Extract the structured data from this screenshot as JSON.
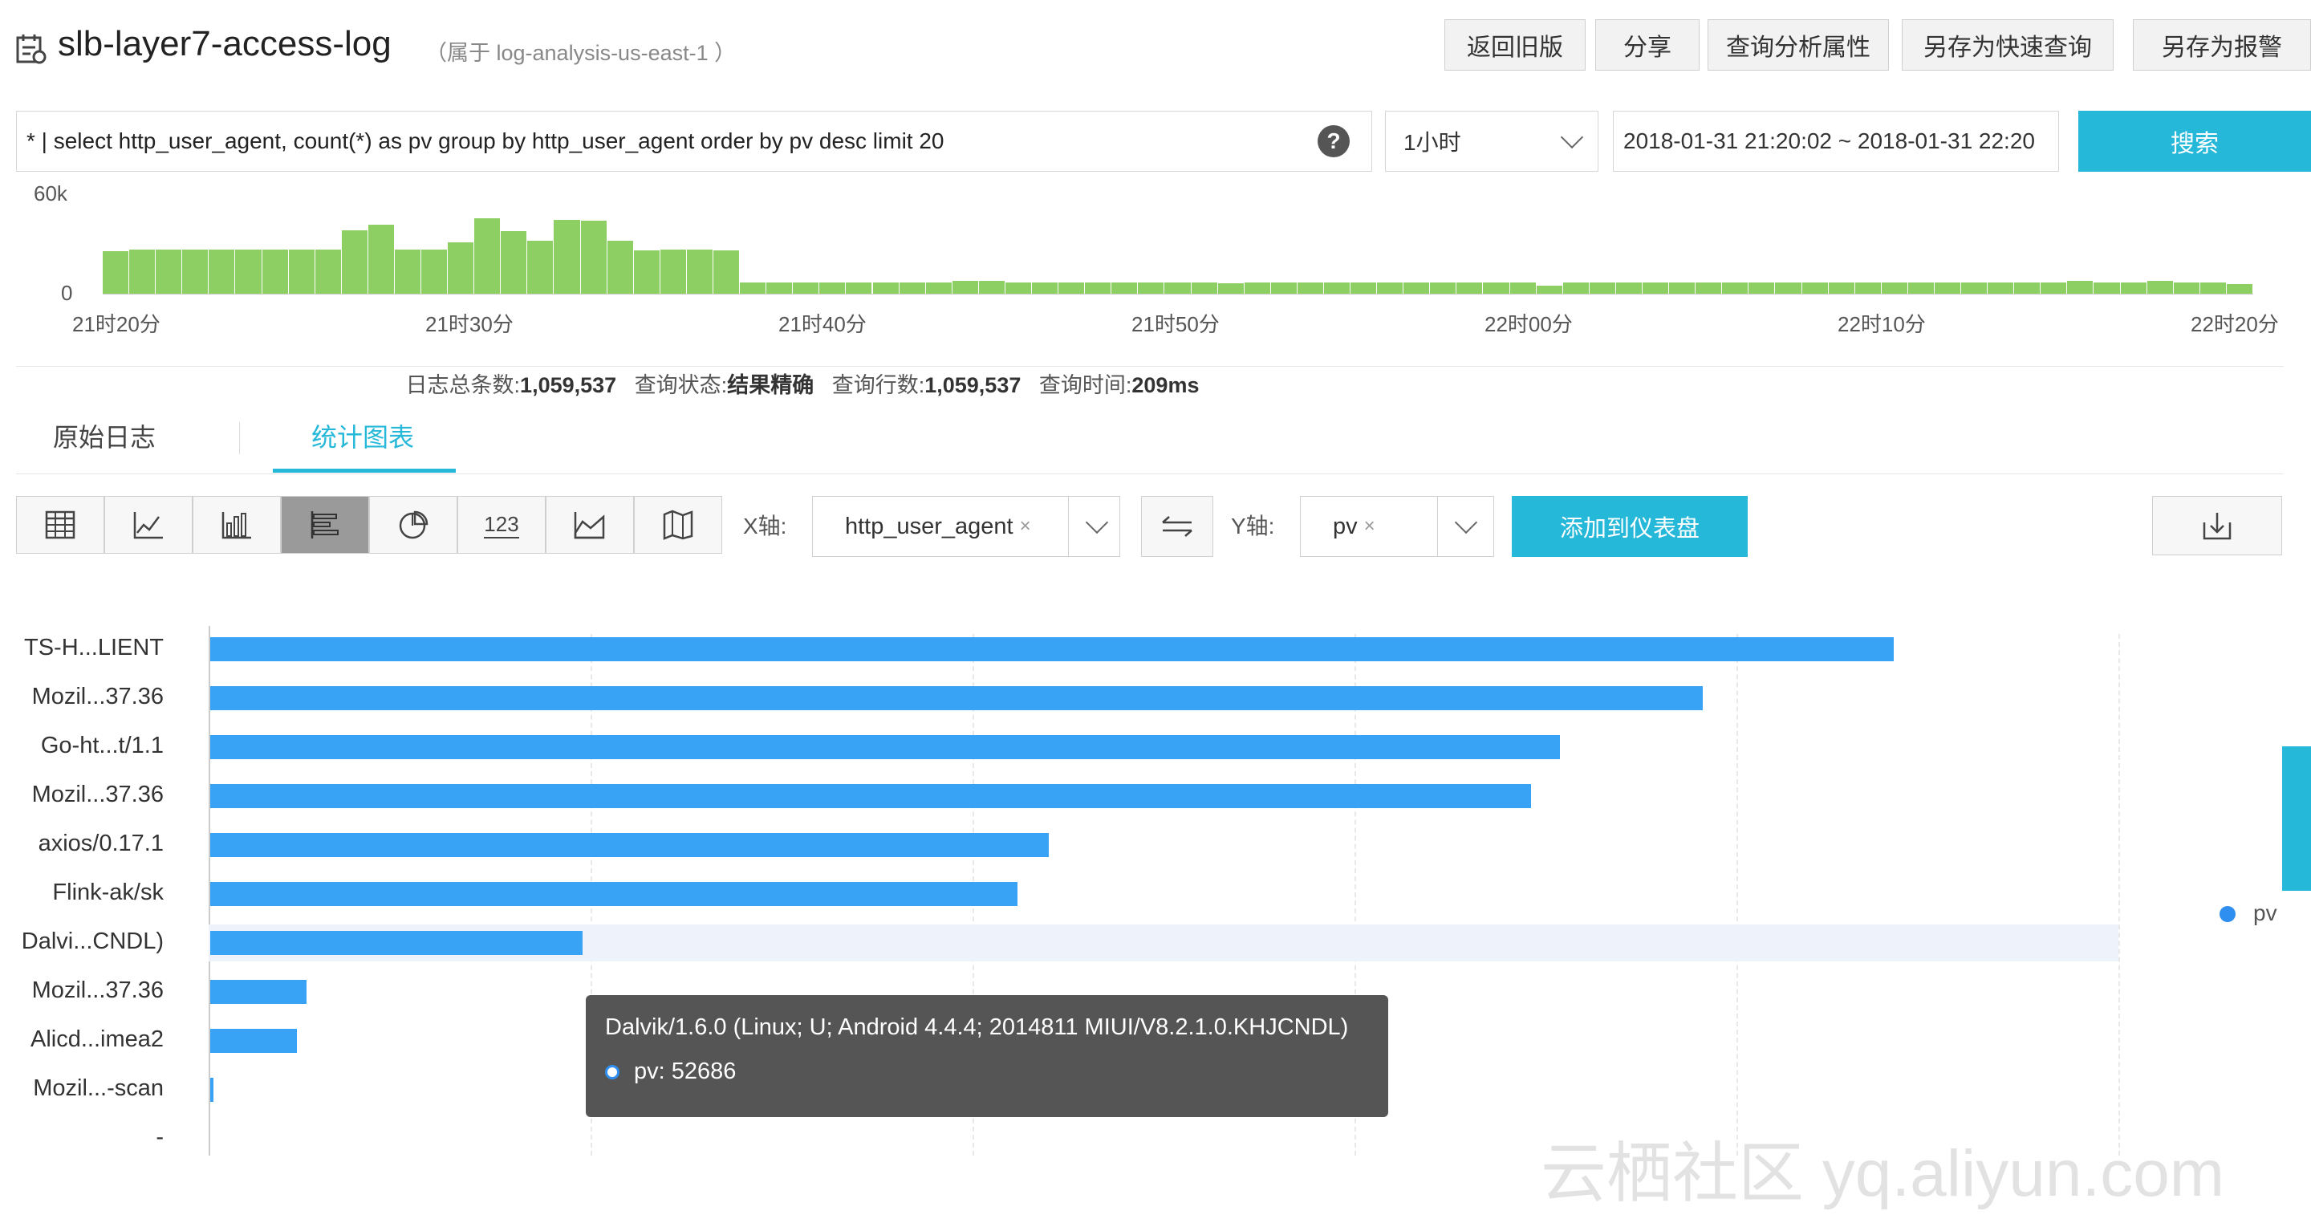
{
  "header": {
    "title": "slb-layer7-access-log",
    "belong": "（属于 log-analysis-us-east-1 ）",
    "buttons": [
      "返回旧版",
      "分享",
      "查询分析属性",
      "另存为快速查询",
      "另存为报警"
    ]
  },
  "query": {
    "text": "* | select http_user_agent, count(*) as pv group by http_user_agent order by pv desc limit 20",
    "help": "?",
    "range": "1小时",
    "time": "2018-01-31 21:20:02 ~ 2018-01-31 22:20",
    "search": "搜索"
  },
  "histogram": {
    "y_max_label": "60k",
    "y_min_label": "0",
    "x_labels": [
      "21时20分",
      "21时30分",
      "21时40分",
      "21时50分",
      "22时00分",
      "22时10分",
      "22时20分"
    ],
    "values": [
      0.44,
      0.46,
      0.46,
      0.46,
      0.46,
      0.46,
      0.46,
      0.46,
      0.46,
      0.66,
      0.72,
      0.46,
      0.46,
      0.53,
      0.78,
      0.65,
      0.55,
      0.77,
      0.76,
      0.55,
      0.45,
      0.46,
      0.46,
      0.45,
      0.12,
      0.12,
      0.12,
      0.12,
      0.12,
      0.12,
      0.12,
      0.12,
      0.13,
      0.13,
      0.12,
      0.12,
      0.12,
      0.12,
      0.12,
      0.12,
      0.12,
      0.12,
      0.11,
      0.12,
      0.12,
      0.12,
      0.12,
      0.12,
      0.12,
      0.12,
      0.12,
      0.12,
      0.12,
      0.12,
      0.08,
      0.12,
      0.12,
      0.12,
      0.12,
      0.12,
      0.12,
      0.12,
      0.12,
      0.12,
      0.12,
      0.12,
      0.12,
      0.12,
      0.12,
      0.12,
      0.12,
      0.12,
      0.12,
      0.12,
      0.13,
      0.12,
      0.12,
      0.13,
      0.12,
      0.12,
      0.1
    ]
  },
  "stats": {
    "total_label": "日志总条数:",
    "total": "1,059,537",
    "status_label": "查询状态:",
    "status": "结果精确",
    "rows_label": "查询行数:",
    "rows": "1,059,537",
    "time_label": "查询时间:",
    "time": "209ms"
  },
  "tabs": [
    "原始日志",
    "统计图表"
  ],
  "toolbar": {
    "icons": [
      "table-icon",
      "line-chart-icon",
      "column-chart-icon",
      "bar-chart-icon",
      "pie-chart-icon",
      "number-icon",
      "area-chart-icon",
      "map-icon"
    ],
    "number_glyph": "123",
    "x_label": "X轴:",
    "x_value": "http_user_agent",
    "y_label": "Y轴:",
    "y_value": "pv",
    "tag_close": "×",
    "add_button": "添加到仪表盘"
  },
  "chart_data": {
    "type": "bar",
    "orientation": "horizontal",
    "categories": [
      "TS-H...LIENT",
      "Mozil...37.36",
      "Go-ht...t/1.1",
      "Mozil...37.36",
      "axios/0.17.1",
      "Flink-ak/sk",
      "Dalvi...CNDL)",
      "Mozil...37.36",
      "Alicd...imea2",
      "Mozil...-scan",
      "-"
    ],
    "values": [
      238000,
      211000,
      190800,
      186700,
      118500,
      114100,
      52686,
      13600,
      12300,
      400,
      0
    ],
    "x_max": 270000,
    "highlight_index": 6,
    "legend": [
      "pv"
    ],
    "legend_position": "right"
  },
  "tooltip": {
    "title": "Dalvik/1.6.0 (Linux; U; Android 4.4.4; 2014811 MIUI/V8.2.1.0.KHJCNDL)",
    "line": "pv: 52686"
  },
  "watermark": "云栖社区 yq.aliyun.com"
}
